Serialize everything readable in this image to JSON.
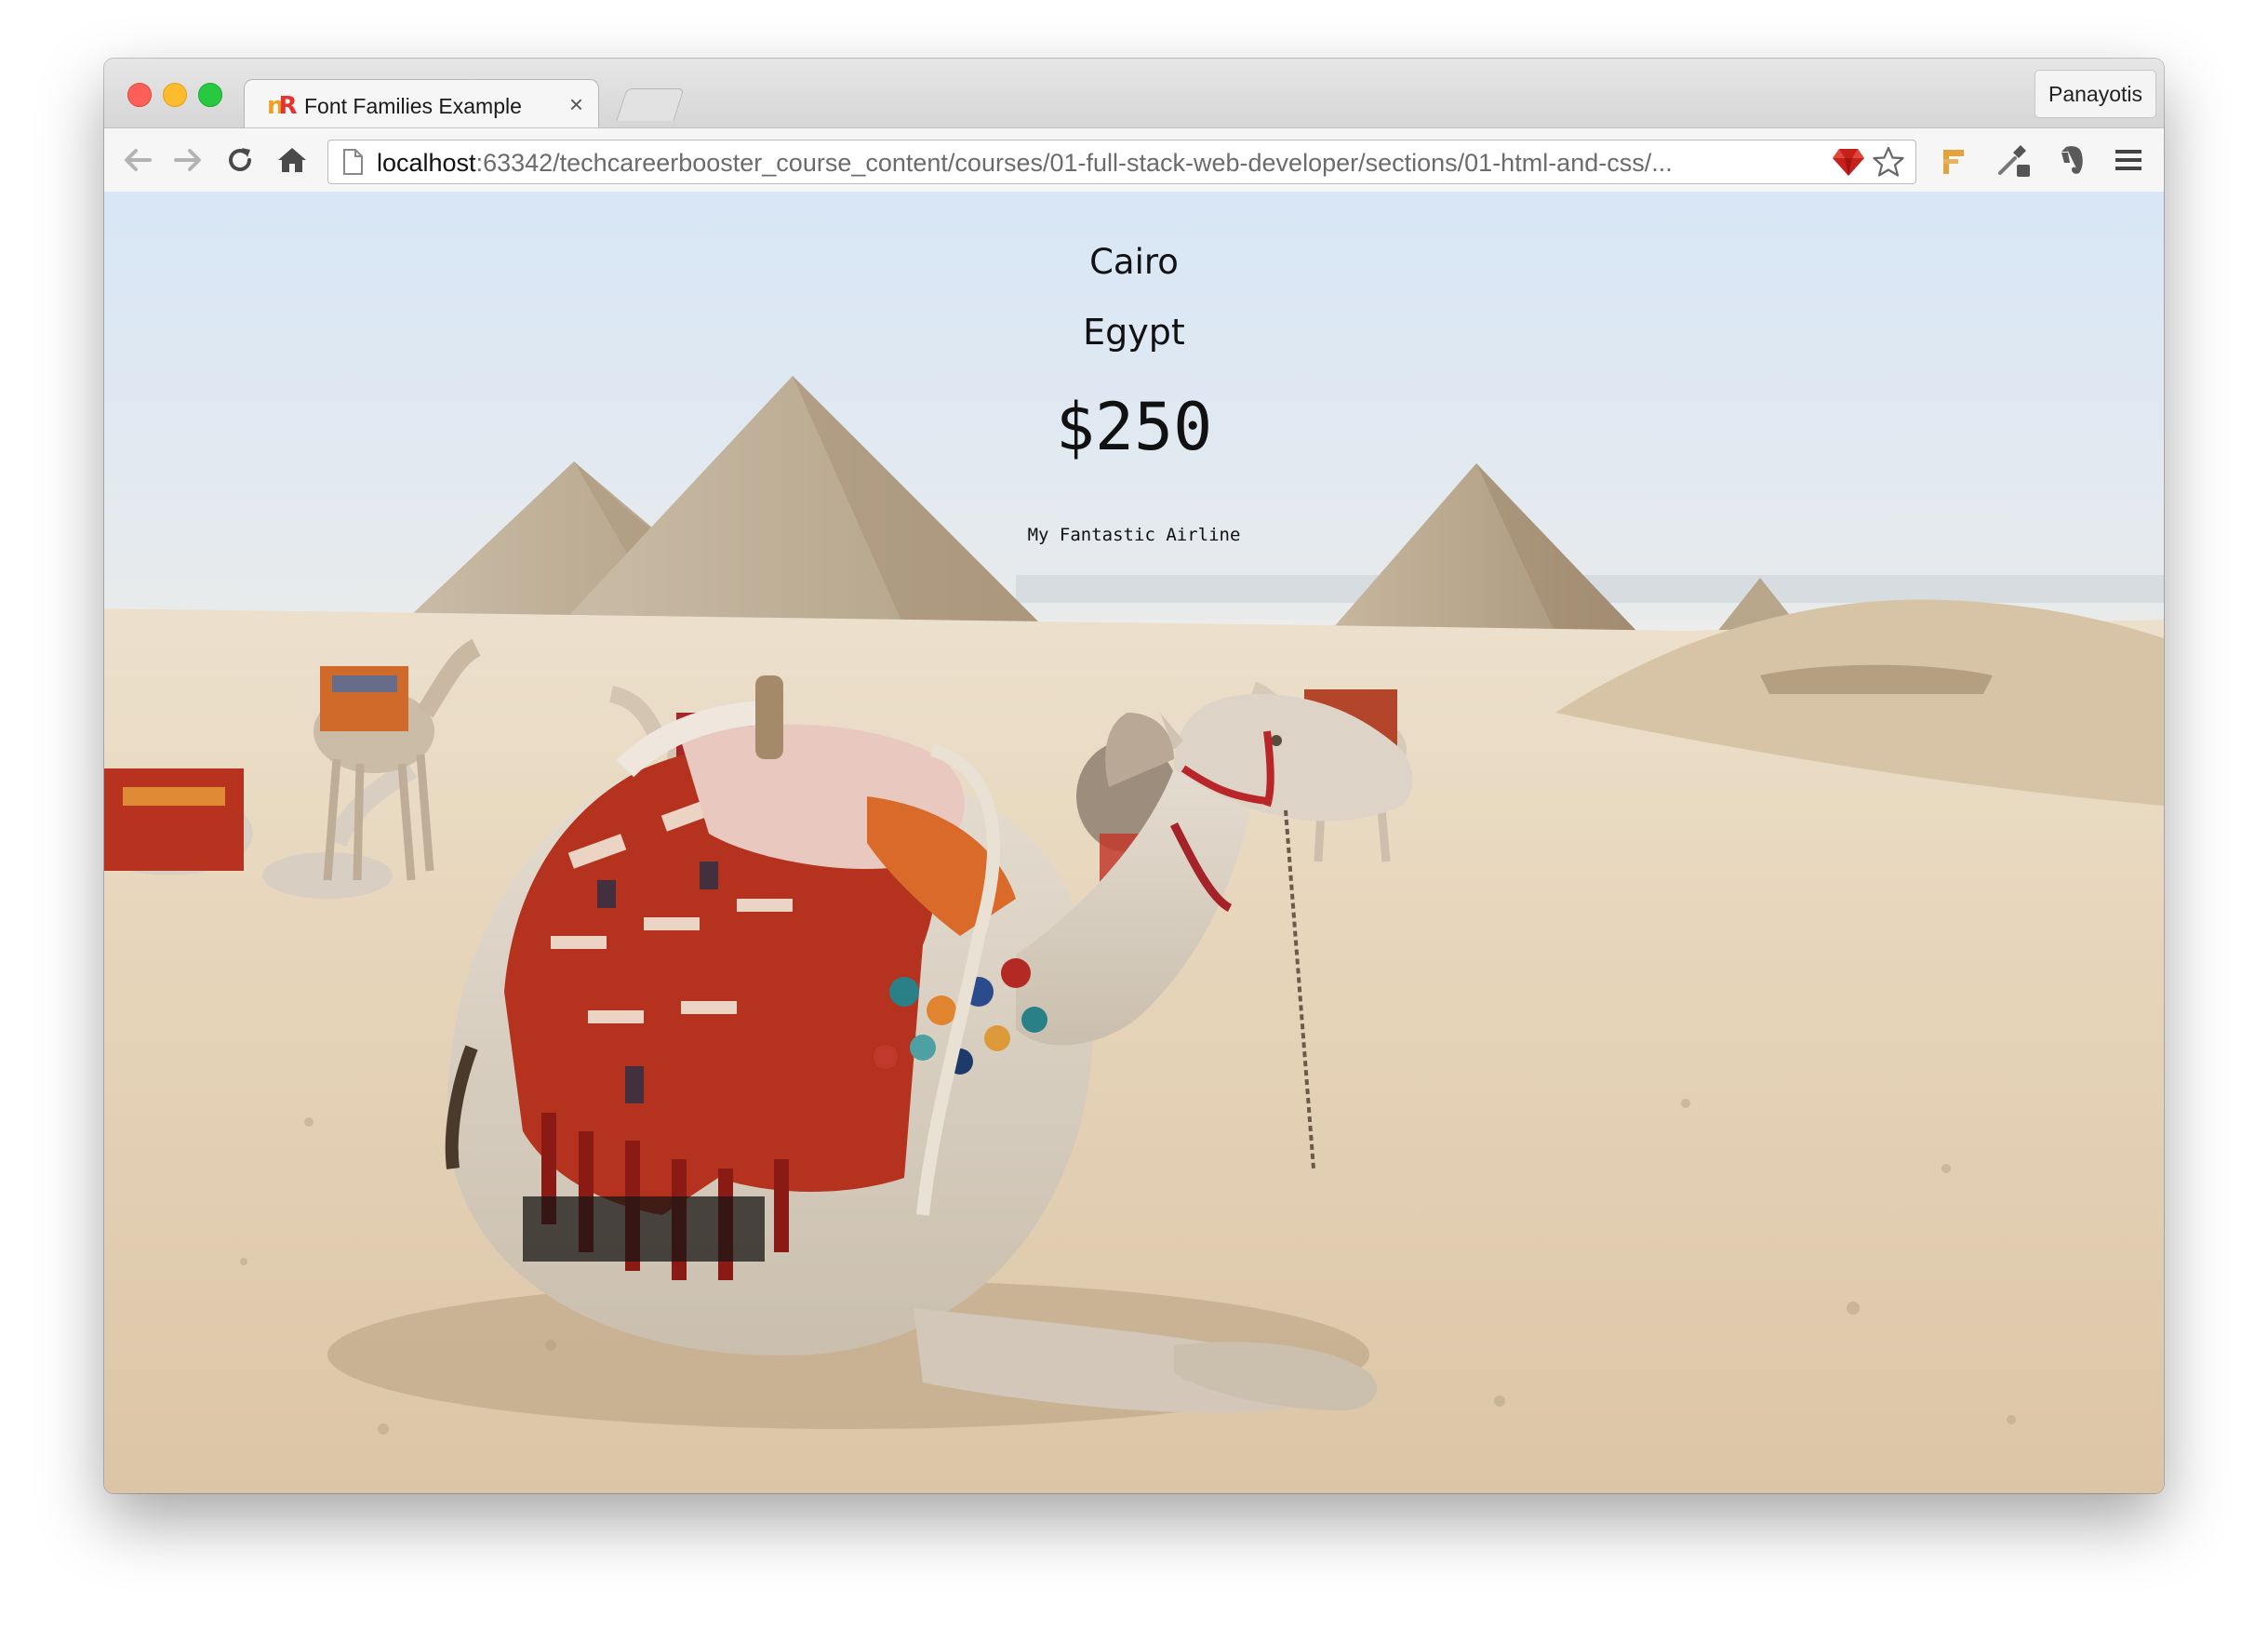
{
  "browser": {
    "tab_title": "Font Families Example",
    "tab_close": "×",
    "profile_name": "Panayotis",
    "url_host": "localhost",
    "url_rest": ":63342/techcareerbooster_course_content/courses/01-full-stack-web-developer/sections/01-html-and-css/..."
  },
  "page": {
    "city": "Cairo",
    "country": "Egypt",
    "price": "$250",
    "airline": "My Fantastic Airline"
  },
  "colors": {
    "sky": "#dce8f4",
    "sand": "#e3cfb2",
    "pyramid": "#bfae95",
    "close": "#fc5f57",
    "minimize": "#fdbc2e",
    "maximize": "#28c840"
  }
}
